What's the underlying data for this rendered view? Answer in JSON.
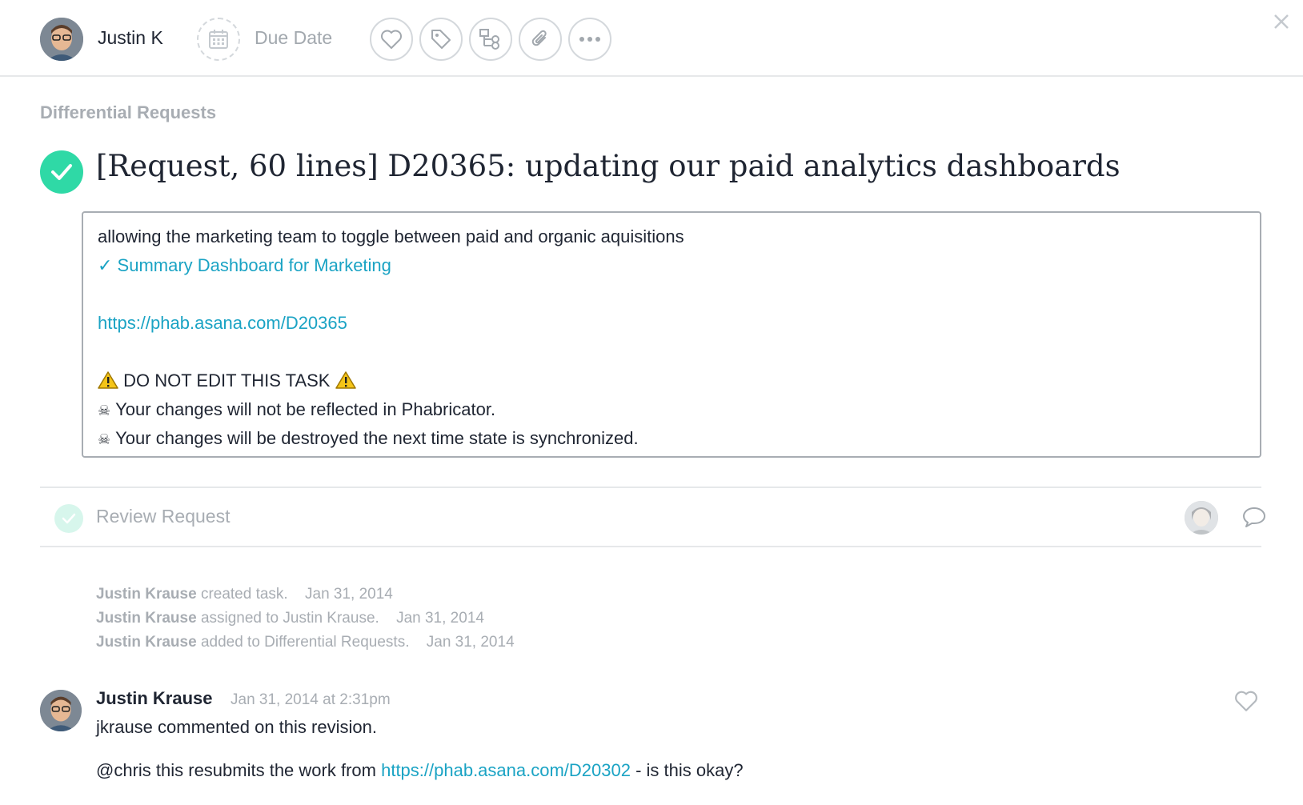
{
  "toolbar": {
    "assignee_name": "Justin K",
    "due_date_placeholder": "Due Date",
    "buttons": [
      {
        "icon": "heart-icon"
      },
      {
        "icon": "tag-icon"
      },
      {
        "icon": "subtasks-icon"
      },
      {
        "icon": "attachment-icon"
      },
      {
        "icon": "more-icon"
      }
    ]
  },
  "project": {
    "name": "Differential Requests"
  },
  "task": {
    "title": "[Request, 60 lines] D20365: updating our paid analytics dashboards",
    "completed": true
  },
  "description": {
    "line1": "allowing the marketing team to toggle between paid and organic aquisitions",
    "linked_task": "✓ Summary Dashboard for Marketing",
    "url": "https://phab.asana.com/D20365",
    "warning": "DO NOT EDIT THIS TASK",
    "note1": "Your changes will not be reflected in Phabricator.",
    "note2": "Your changes will be destroyed the next time state is synchronized."
  },
  "subtask": {
    "name": "Review Request",
    "completed": true
  },
  "stories": [
    {
      "actor": "Justin Krause",
      "action": "created task.",
      "date": "Jan 31, 2014"
    },
    {
      "actor": "Justin Krause",
      "action": "assigned to Justin Krause.",
      "date": "Jan 31, 2014"
    },
    {
      "actor": "Justin Krause",
      "action": "added to Differential Requests.",
      "date": "Jan 31, 2014"
    }
  ],
  "comment": {
    "author": "Justin Krause",
    "time": "Jan 31, 2014 at 2:31pm",
    "line1": "jkrause commented on this revision.",
    "line2_prefix": "@chris this resubmits the work from ",
    "line2_link": "https://phab.asana.com/D20302",
    "line2_suffix": " - is this okay?"
  },
  "colors": {
    "complete_green": "#2fd9a6",
    "link_blue": "#14aaf5",
    "muted_text": "#a8adb3",
    "border": "#e6e8ea"
  }
}
